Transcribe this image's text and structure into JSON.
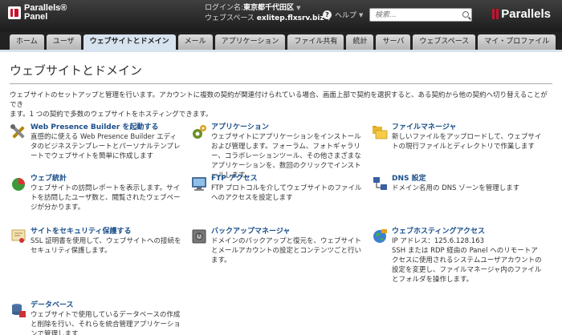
{
  "header": {
    "logo_line1": "Parallels®",
    "logo_line2": "Panel",
    "login_label": "ログイン名:",
    "login_user": "東京都千代田区",
    "webspace_label": "ウェブスペース",
    "webspace_value": "exlitep.flxsrv.biz",
    "help_label": "ヘルプ",
    "search_placeholder": "検索...",
    "brand": "Parallels"
  },
  "nav": {
    "tabs": [
      {
        "label": "ホーム"
      },
      {
        "label": "ユーザ"
      },
      {
        "label": "ウェブサイトとドメイン"
      },
      {
        "label": "メール"
      },
      {
        "label": "アプリケーション"
      },
      {
        "label": "ファイル共有"
      },
      {
        "label": "統計"
      },
      {
        "label": "サーバ"
      },
      {
        "label": "ウェブスペース"
      },
      {
        "label": "マイ・プロファイル"
      }
    ],
    "active_index": 2
  },
  "main": {
    "title": "ウェブサイトとドメイン",
    "intro_line1": "ウェブサイトのセットアップと管理を行います。アカウントに複数の契約が関連付けられている場合、画面上部で契約を選択すると、ある契約から他の契約へ切り替えることができ",
    "intro_line2": "ます。1 つの契約で多数のウェブサイトをホスティングできます。",
    "items": [
      {
        "title": "Web Presence Builder を起動する",
        "desc": "直感的に使える Web Presence Builder エディタのビジネステンプレートとパーソナルテンプレートでウェブサイトを簡単に作成します",
        "icon": "tools-icon"
      },
      {
        "title": "アプリケーション",
        "desc": "ウェブサイトにアプリケーションをインストールおよび管理します。フォーラム、フォトギャラリー、コラボレーションツール、その他さまざまなアプリケーションを、数回のクリックでインストールします。",
        "icon": "applications-icon"
      },
      {
        "title": "ファイルマネージャ",
        "desc": "新しいファイルをアップロードして、ウェブサイトの現行ファイルとディレクトリで作業します",
        "icon": "folders-icon"
      },
      {
        "title": "ウェブ統計",
        "desc": "ウェブサイトの訪問レポートを表示します。サイトを訪問したユーザ数と、閲覧されたウェブページが分かります。",
        "icon": "pie-chart-icon"
      },
      {
        "title": "FTP アクセス",
        "desc": "FTP プロトコルを介してウェブサイトのファイルへのアクセスを設定します",
        "icon": "monitor-icon"
      },
      {
        "title": "DNS 設定",
        "desc": "ドメイン名用の DNS ゾーンを管理します",
        "icon": "dns-icon"
      },
      {
        "title": "サイトをセキュリティ保護する",
        "desc": "SSL 証明書を使用して、ウェブサイトへの接続をセキュリティ保護します。",
        "icon": "certificate-icon"
      },
      {
        "title": "バックアップマネージャ",
        "desc": "ドメインのバックアップと復元を、ウェブサイトとメールアカウントの設定とコンテンツごと行います。",
        "icon": "backup-safe-icon"
      },
      {
        "title": "ウェブホスティングアクセス",
        "desc": "IP アドレス：125.6.128.163\nSSH または RDP 経由の Panel へのリモートアクセスに使用されるシステムユーザアカウントの設定を変更し、ファイルマネージャ内のファイルとフォルダを操作します。",
        "icon": "globe-icon"
      },
      {
        "title": "データベース",
        "desc": "ウェブサイトで使用しているデータベースの作成と削除を行い、それらを統合管理アプリケーションで管理します",
        "icon": "database-icon"
      }
    ]
  },
  "colors": {
    "header_dark": "#1c1c1c",
    "link_blue": "#1a4f8a",
    "tab_active": "#d7e3ee",
    "brand_red": "#c8102e"
  }
}
